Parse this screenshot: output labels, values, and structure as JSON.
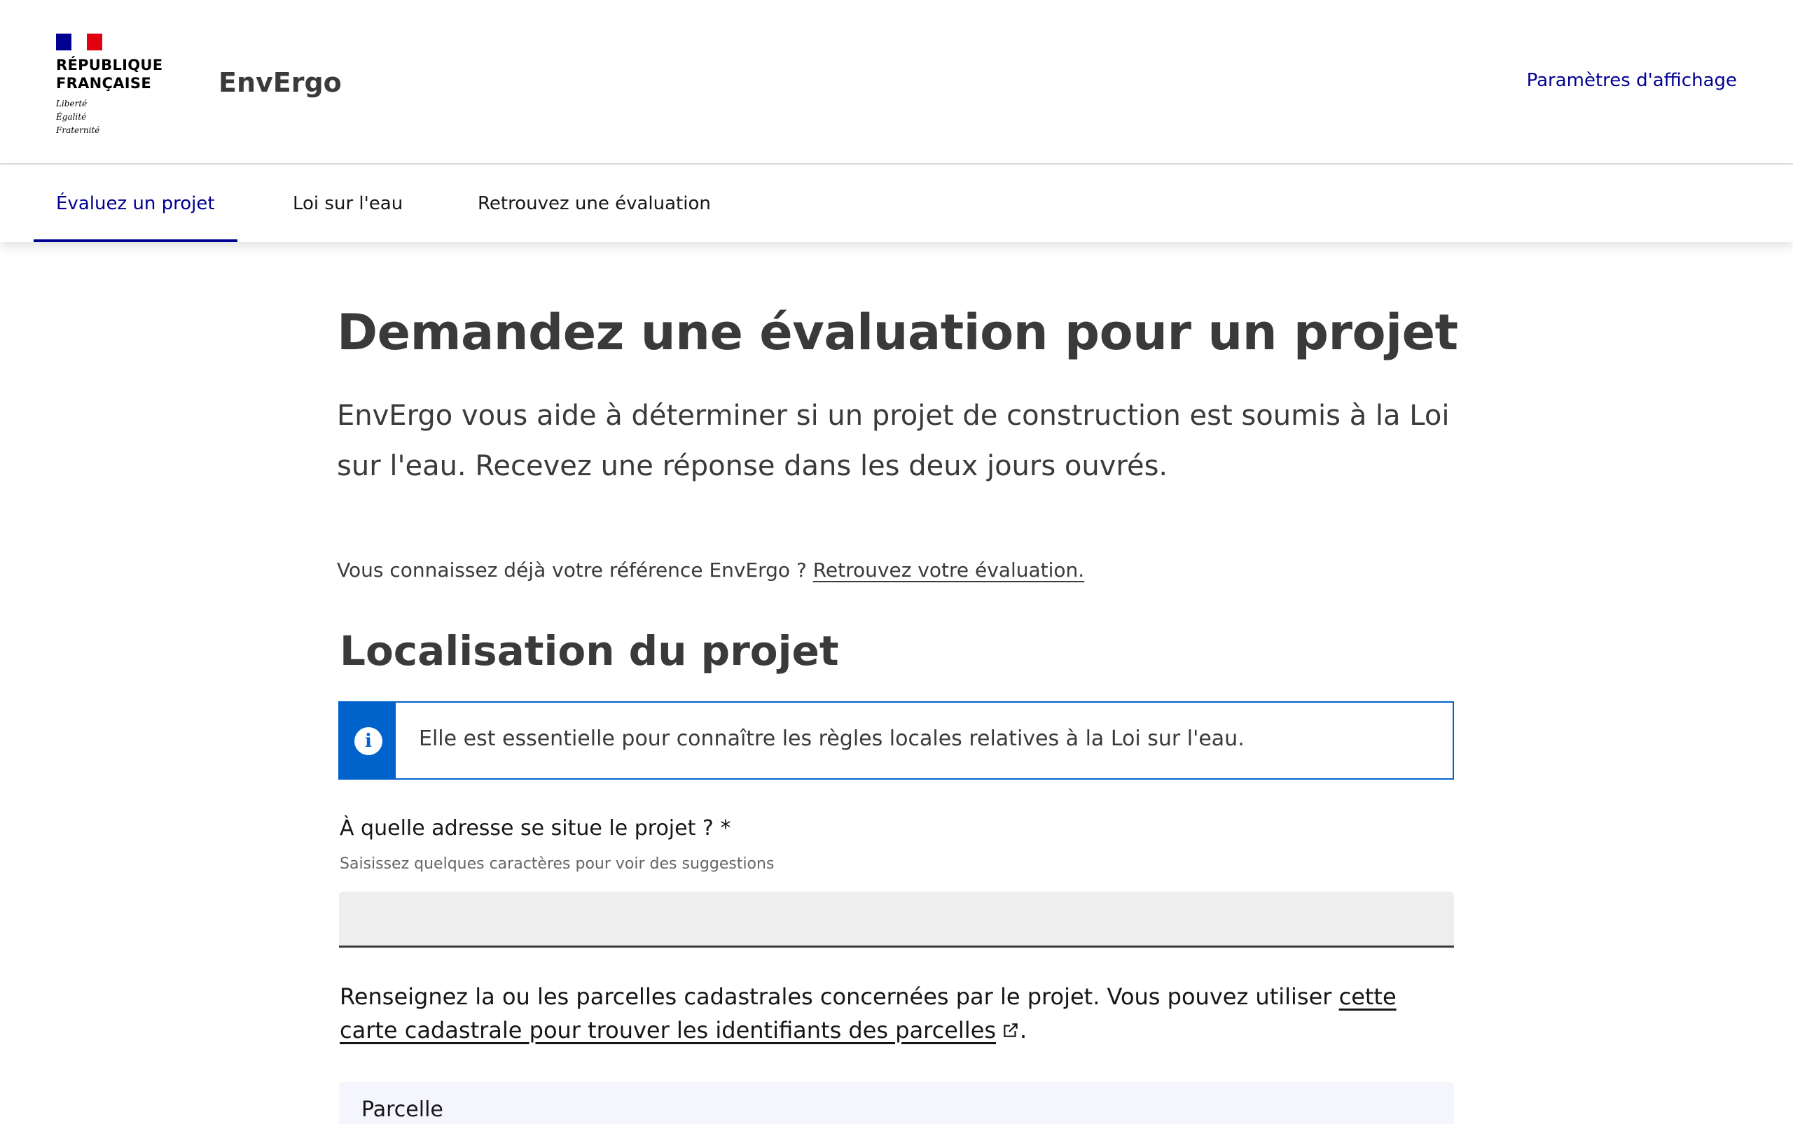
{
  "header": {
    "flag_colors": {
      "blue": "#000091",
      "white": "#ffffff",
      "red": "#e1000f"
    },
    "republic_name": "RÉPUBLIQUE\nFRANÇAISE",
    "motto": "Liberté\nÉgalité\nFraternité",
    "service_title": "EnvErgo",
    "display_settings_label": "Paramètres d'affichage"
  },
  "nav": {
    "items": [
      {
        "label": "Évaluez un projet",
        "active": true
      },
      {
        "label": "Loi sur l'eau",
        "active": false
      },
      {
        "label": "Retrouvez une évaluation",
        "active": false
      }
    ]
  },
  "main": {
    "title": "Demandez une évaluation pour un projet",
    "lead": "EnvErgo vous aide à déterminer si un projet de construction est soumis à la Loi sur l'eau. Recevez une réponse dans les deux jours ouvrés.",
    "ref_prefix": "Vous connaissez déjà votre référence EnvErgo ?",
    "ref_link": "Retrouvez votre évaluation.",
    "section_title": "Localisation du projet",
    "notice": {
      "icon": "info-icon",
      "text": "Elle est essentielle pour connaître les règles locales relatives à la Loi sur l'eau."
    },
    "address_field": {
      "label": "À quelle adresse se situe le projet ? *",
      "hint": "Saisissez quelques caractères pour voir des suggestions",
      "value": ""
    },
    "parcel_intro_before": "Renseignez la ou les parcelles cadastrales concernées par le projet. Vous pouvez utiliser",
    "parcel_intro_link": "cette carte cadastrale pour trouver les identifiants des parcelles",
    "parcel_intro_after": ".",
    "parcel_box_label": "Parcelle"
  },
  "colors": {
    "accent": "#000091",
    "info": "#0063cb",
    "text": "#3a3a3a"
  }
}
